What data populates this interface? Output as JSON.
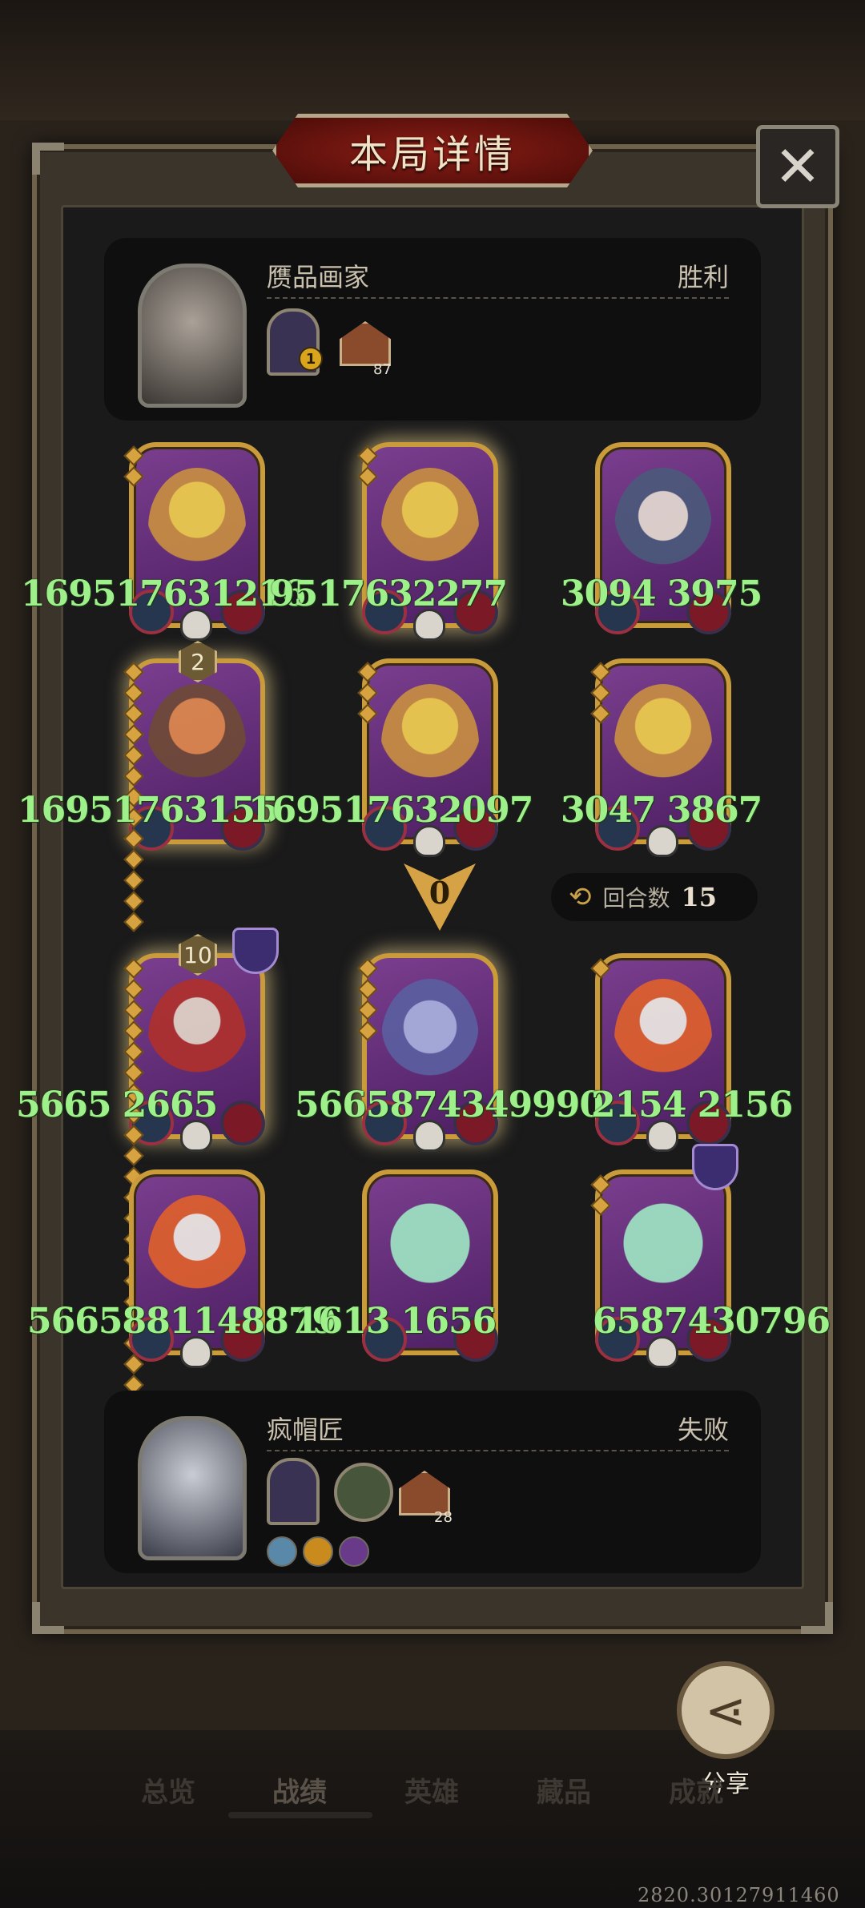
{
  "dialog": {
    "title": "本局详情",
    "close_label": "✕"
  },
  "winner": {
    "name": "赝品画家",
    "result": "胜利",
    "house_count": "87",
    "item_badge": "1"
  },
  "loser": {
    "name": "疯帽匠",
    "result": "失败",
    "house_count": "28"
  },
  "board_top": {
    "row1": [
      {
        "numbers": "169517631216",
        "level": ""
      },
      {
        "numbers": "9517632277",
        "level": ""
      },
      {
        "numbers": "3094 3975",
        "level": ""
      }
    ],
    "row2": [
      {
        "numbers": "16951763155",
        "level": "2"
      },
      {
        "numbers": "169517632097",
        "level": ""
      },
      {
        "numbers": "3047 3867",
        "level": ""
      }
    ]
  },
  "divider": {
    "marker": "0",
    "round_label": "回合数",
    "round_value": "15"
  },
  "board_bottom": {
    "row1": [
      {
        "numbers": "5665 2665",
        "level": "10"
      },
      {
        "numbers": "5665874349990",
        "level": ""
      },
      {
        "numbers": "2154 2156",
        "level": ""
      }
    ],
    "row2": [
      {
        "numbers": "5665881148879",
        "level": ""
      },
      {
        "numbers": "1613 1656",
        "level": ""
      },
      {
        "numbers": "6587430796",
        "level": ""
      }
    ]
  },
  "share": {
    "label": "分享"
  },
  "nav": [
    "总览",
    "战绩",
    "英雄",
    "藏品",
    "成就"
  ],
  "footer": {
    "coords": "2820.30127911460"
  },
  "colors": {
    "card_number": "#9ef08a",
    "frame_gold": "#c99b3b",
    "title_red": "#8b1d16"
  },
  "icons": {
    "close": "close-icon",
    "share": "share-icon",
    "round": "cycle-icon",
    "house": "house-icon"
  }
}
